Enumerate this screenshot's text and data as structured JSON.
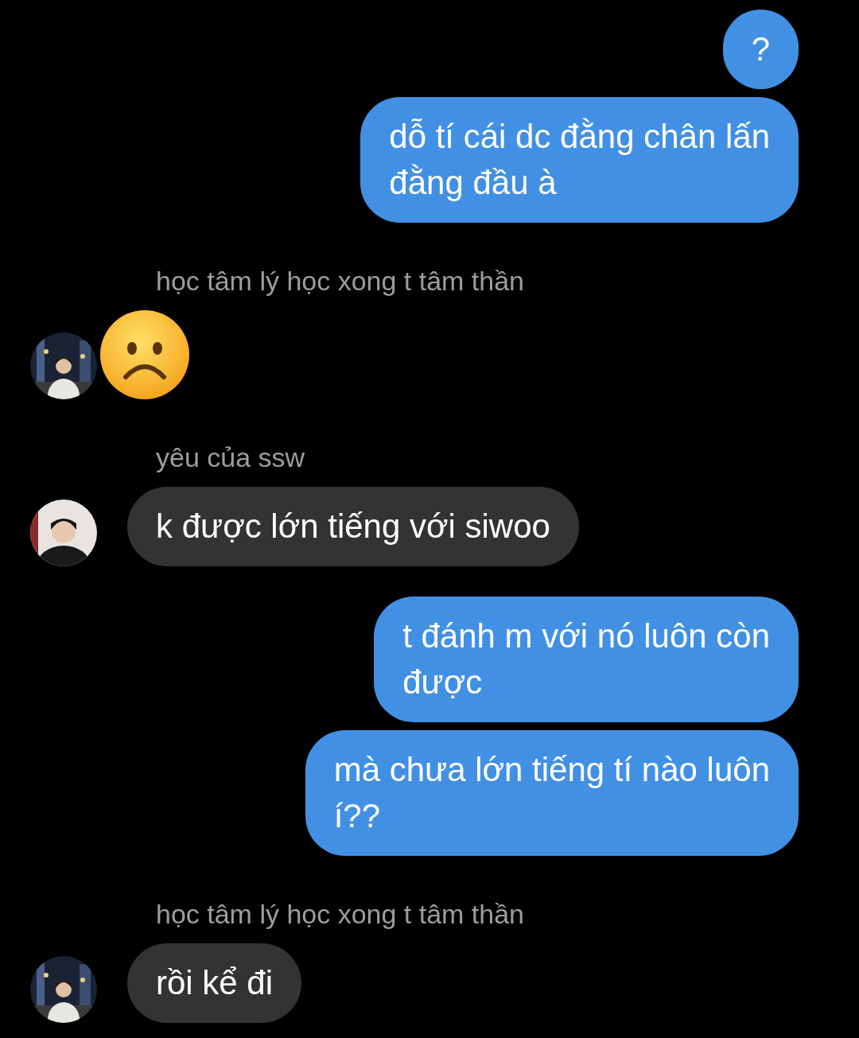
{
  "messages": [
    {
      "kind": "outgoing",
      "lines": [
        "?"
      ]
    },
    {
      "kind": "outgoing",
      "lines": [
        "dỗ tí cái dc đằng chân lấn",
        "đằng đầu à"
      ]
    },
    {
      "kind": "emoji",
      "sender": "học tâm lý học xong t tâm thần"
    },
    {
      "kind": "incoming",
      "sender": "yêu của ssw",
      "lines": [
        "k được lớn tiếng với siwoo"
      ]
    },
    {
      "kind": "outgoing",
      "lines": [
        "t đánh m với nó luôn còn",
        "được"
      ]
    },
    {
      "kind": "outgoing",
      "lines": [
        "mà chưa lớn tiếng tí nào luôn",
        "í??"
      ]
    },
    {
      "kind": "incoming",
      "sender": "học tâm lý học xong t tâm thần",
      "lines": [
        "rồi kể đi"
      ]
    }
  ]
}
